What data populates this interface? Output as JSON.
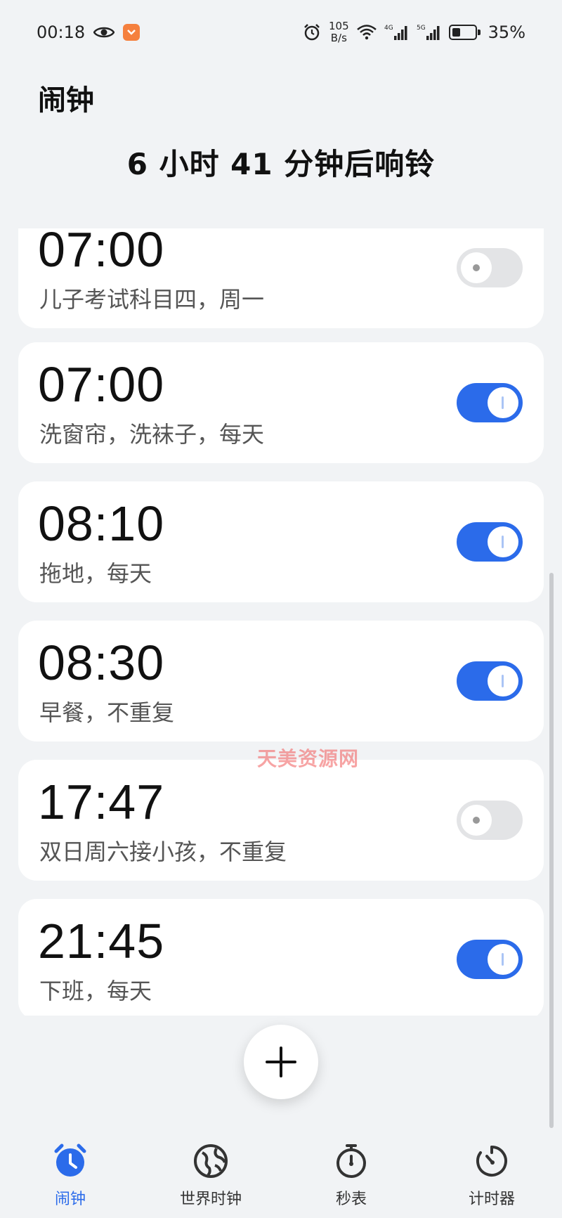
{
  "status_bar": {
    "time": "00:18",
    "net_speed_value": "105",
    "net_speed_unit": "B/s",
    "sig1_label": "4G",
    "sig2_label": "5G",
    "battery": "35%",
    "battery_level": 0.35
  },
  "header": {
    "title": "闹钟",
    "next_ring": "6 小时 41 分钟后响铃"
  },
  "alarms": [
    {
      "time": "07:00",
      "label": "儿子考试科目四，周一",
      "enabled": false
    },
    {
      "time": "07:00",
      "label": "洗窗帘，洗袜子，每天",
      "enabled": true
    },
    {
      "time": "08:10",
      "label": "拖地，每天",
      "enabled": true
    },
    {
      "time": "08:30",
      "label": "早餐，不重复",
      "enabled": true
    },
    {
      "time": "17:47",
      "label": "双日周六接小孩，不重复",
      "enabled": false
    },
    {
      "time": "21:45",
      "label": "下班，每天",
      "enabled": true
    }
  ],
  "watermark": "天美资源网",
  "bottom_nav": [
    {
      "label": "闹钟",
      "active": true
    },
    {
      "label": "世界时钟",
      "active": false
    },
    {
      "label": "秒表",
      "active": false
    },
    {
      "label": "计时器",
      "active": false
    }
  ],
  "colors": {
    "accent": "#2b6bea",
    "toggle_off": "#e3e4e6",
    "background": "#f1f3f5"
  }
}
